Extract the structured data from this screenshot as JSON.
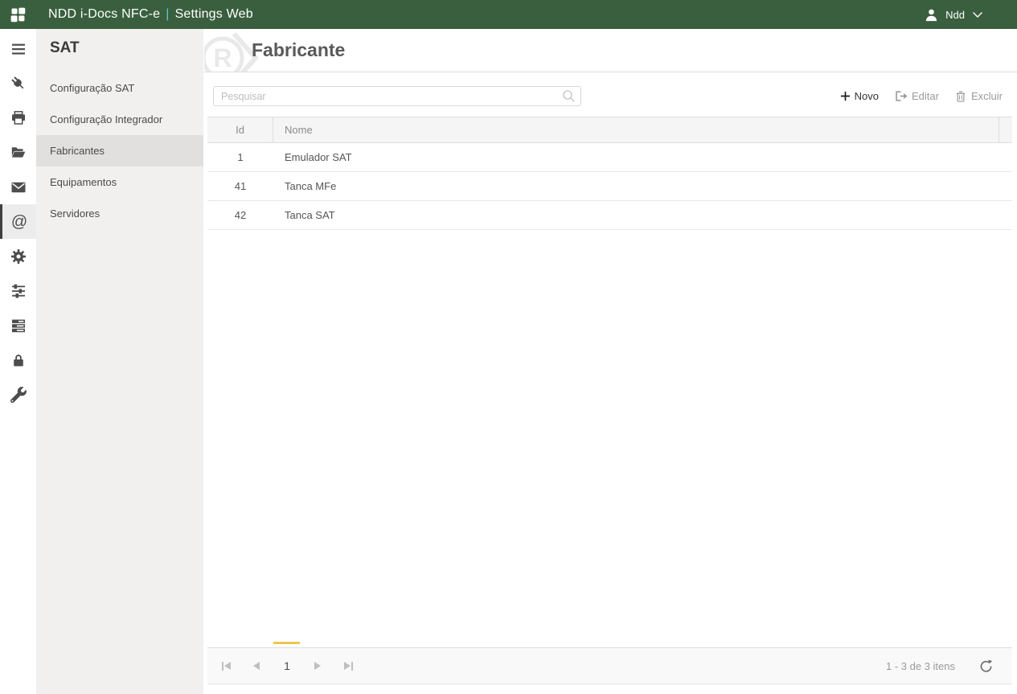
{
  "colors": {
    "topbar_bg": "#3a5f3e",
    "title_divider": "#5bc8d8",
    "pager_active_accent": "#ecc64f",
    "rail_icon": "#4d4d4d"
  },
  "topbar": {
    "product": "NDD i-Docs NFC-e",
    "divider": "|",
    "module": "Settings Web",
    "user": {
      "name": "Ndd"
    }
  },
  "icon_rail": {
    "items": [
      "menu",
      "plug",
      "printer",
      "folder-open",
      "envelope",
      "at-sign",
      "gear",
      "sliders",
      "server",
      "lock",
      "wrench"
    ],
    "selected": "at-sign",
    "at_glyph": "@"
  },
  "sidebar": {
    "title": "SAT",
    "items": [
      {
        "label": "Configuração SAT",
        "selected": false
      },
      {
        "label": "Configuração Integrador",
        "selected": false
      },
      {
        "label": "Fabricantes",
        "selected": true
      },
      {
        "label": "Equipamentos",
        "selected": false
      },
      {
        "label": "Servidores",
        "selected": false
      }
    ]
  },
  "main": {
    "page_title": "Fabricante",
    "search": {
      "placeholder": "Pesquisar",
      "value": ""
    },
    "toolbar": {
      "new_label": "Novo",
      "edit_label": "Editar",
      "delete_label": "Excluir"
    },
    "table": {
      "columns": [
        "Id",
        "Nome"
      ],
      "rows": [
        {
          "id": "1",
          "nome": "Emulador SAT"
        },
        {
          "id": "41",
          "nome": "Tanca MFe"
        },
        {
          "id": "42",
          "nome": "Tanca SAT"
        }
      ]
    },
    "pager": {
      "current_page": "1",
      "info": "1 - 3 de 3 itens"
    }
  }
}
